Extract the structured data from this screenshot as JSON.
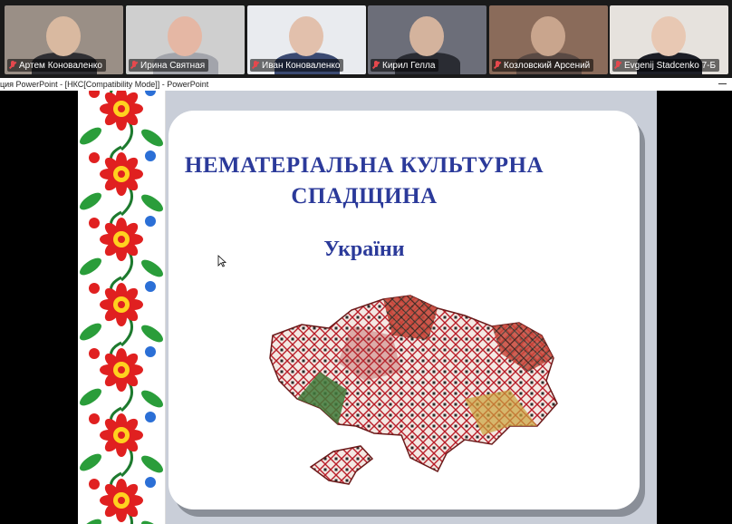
{
  "participants": [
    {
      "name": "Артем Коноваленко",
      "muted": true,
      "active": false,
      "bg": "#9a8f86",
      "skin": "#d9b9a0",
      "shirt": "#2f2f33"
    },
    {
      "name": "Ирина Святная",
      "muted": true,
      "active": true,
      "bg": "#cfcfcf",
      "skin": "#e5b7a4",
      "shirt": "#a2a4ab"
    },
    {
      "name": "Иван Коноваленко",
      "muted": true,
      "active": false,
      "bg": "#e9ebef",
      "skin": "#e2c0ac",
      "shirt": "#3b4a72"
    },
    {
      "name": "Кирил Гелла",
      "muted": true,
      "active": false,
      "bg": "#6c6e79",
      "skin": "#d4b39d",
      "shirt": "#2a2c33"
    },
    {
      "name": "Козловский Арсений",
      "muted": true,
      "active": false,
      "bg": "#8a6b5a",
      "skin": "#c9a58d",
      "shirt": "#5a4a44"
    },
    {
      "name": "Evgenij Stadcenko 7-Б",
      "muted": true,
      "active": false,
      "bg": "#e6e2dd",
      "skin": "#e8c8b3",
      "shirt": "#1c1e26"
    }
  ],
  "window": {
    "title": "ция PowerPoint - [НКС[Compatibility Mode]] - PowerPoint"
  },
  "slide": {
    "title": "НЕМАТЕРІАЛЬНА КУЛЬТУРНА СПАДЩИНА",
    "subtitle": "України",
    "accent": "#2b3a9a",
    "map_image": "ukraine-map-embroidery-image",
    "ornament": "floral-ornament-image"
  }
}
